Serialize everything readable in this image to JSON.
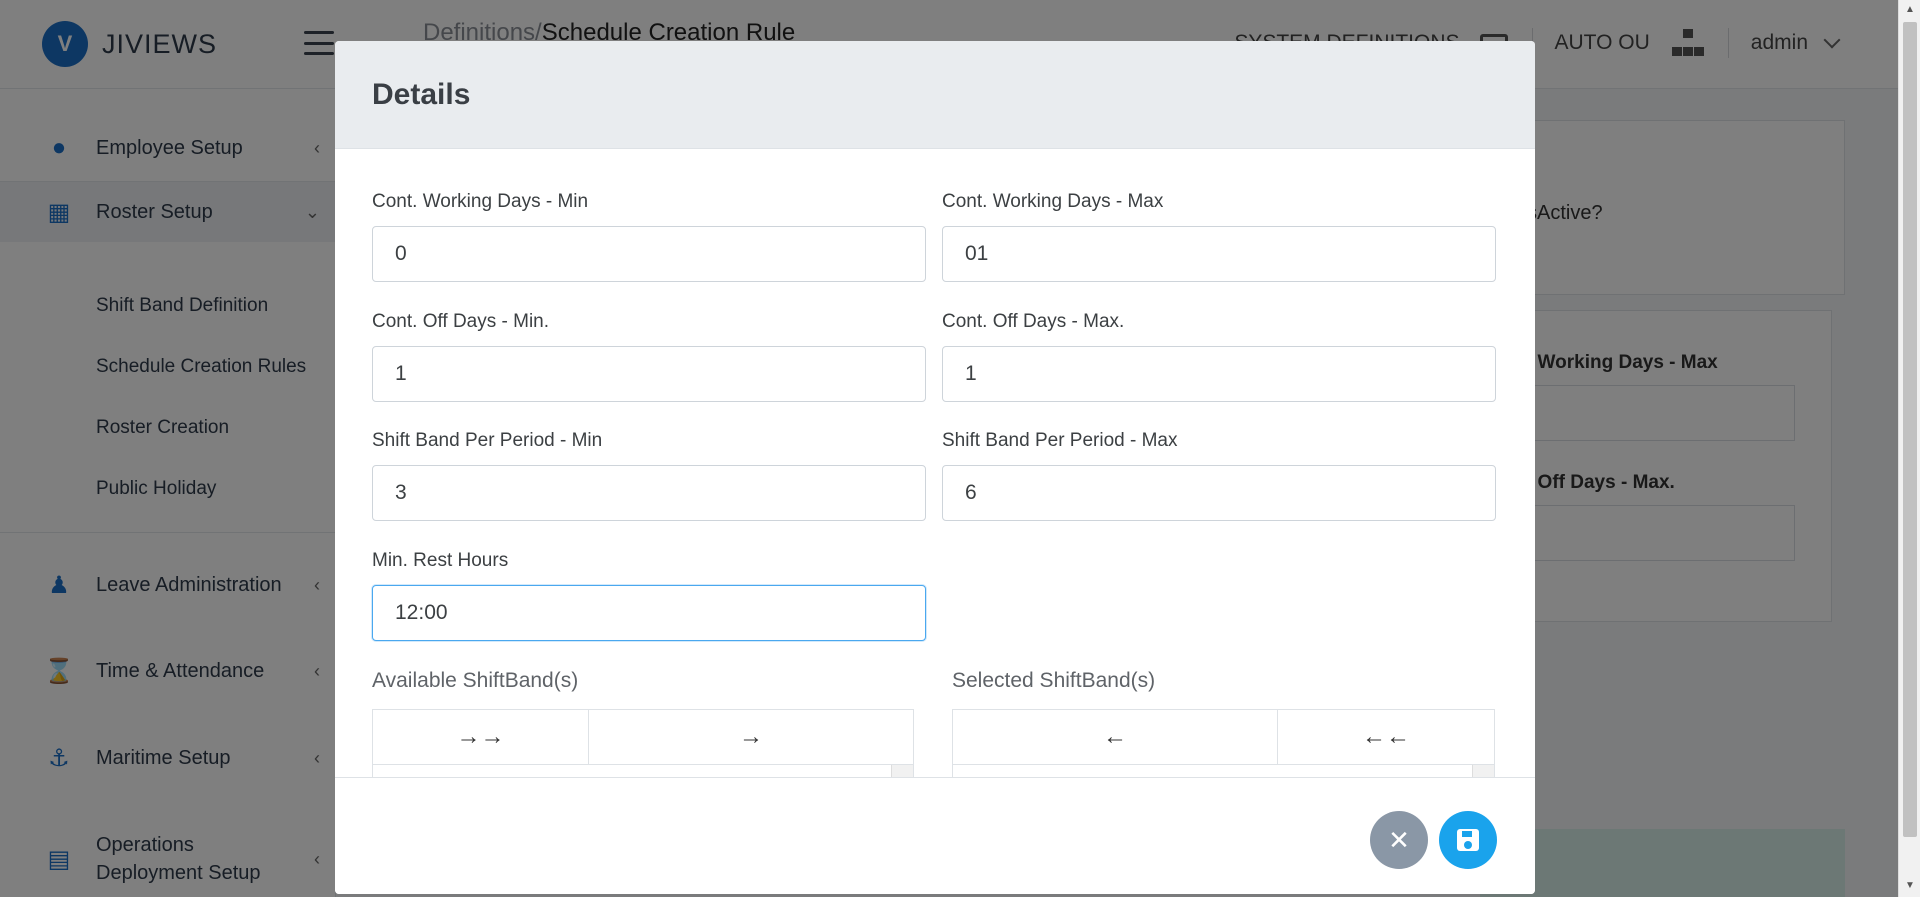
{
  "brand": {
    "name": "JIVIEWS",
    "logo_letter": "V"
  },
  "breadcrumb": {
    "prefix": "Definitions/",
    "current": "Schedule Creation Rule"
  },
  "header": {
    "system_definitions_label": "SYSTEM DEFINITIONS",
    "org_unit_label": "AUTO OU",
    "user_label": "admin"
  },
  "sidebar": {
    "items": [
      {
        "label": "Employee Setup",
        "icon": "person-icon",
        "chevron": "‹"
      },
      {
        "label": "Roster Setup",
        "icon": "calendar-icon",
        "chevron": "⌄"
      },
      {
        "label": "Leave Administration",
        "icon": "figure-icon",
        "chevron": "‹"
      },
      {
        "label": "Time & Attendance",
        "icon": "hourglass-icon",
        "chevron": "‹"
      },
      {
        "label": "Maritime Setup",
        "icon": "anchor-icon",
        "chevron": "‹"
      },
      {
        "label": "Operations Deployment Setup",
        "icon": "deployment-icon",
        "chevron": "‹"
      }
    ],
    "subitems": [
      "Shift Band Definition",
      "Schedule Creation Rules",
      "Roster Creation",
      "Public Holiday"
    ]
  },
  "background": {
    "isactive_label": "sActive?",
    "working_days_max_label": ". Working Days - Max",
    "off_days_max_label": ". Off Days - Max."
  },
  "modal": {
    "title": "Details",
    "fields": {
      "cwd_min": {
        "label": "Cont. Working Days - Min",
        "value": "0"
      },
      "cwd_max": {
        "label": "Cont. Working Days - Max",
        "value": "01"
      },
      "cod_min": {
        "label": "Cont. Off Days - Min.",
        "value": "1"
      },
      "cod_max": {
        "label": "Cont. Off Days - Max.",
        "value": "1"
      },
      "sbp_min": {
        "label": "Shift Band Per Period - Min",
        "value": "3"
      },
      "sbp_max": {
        "label": "Shift Band Per Period - Max",
        "value": "6"
      },
      "rest_hours": {
        "label": "Min. Rest Hours",
        "value": "12:00"
      }
    },
    "available": {
      "label": "Available ShiftBand(s)",
      "move_all_label": "→→",
      "move_selected_label": "→"
    },
    "selected": {
      "label": "Selected ShiftBand(s)",
      "remove_selected_label": "←",
      "remove_all_label": "←←"
    },
    "footer": {
      "close_symbol": "✕"
    }
  },
  "colors": {
    "accent": "#1aa3ec",
    "brand_blue": "#1b6fc7",
    "close_button": "#8a97a6",
    "header_bg": "#e9ecef"
  }
}
